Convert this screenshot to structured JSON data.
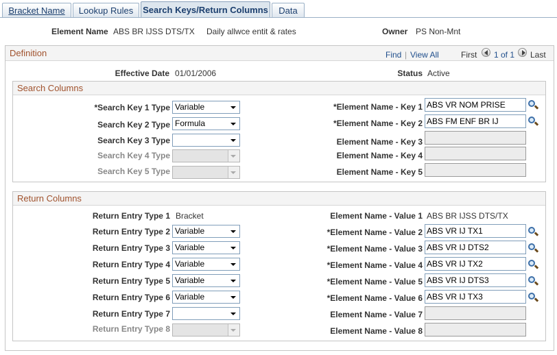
{
  "tabs": [
    {
      "label": "Bracket Name"
    },
    {
      "label": "Lookup Rules"
    },
    {
      "label": "Search Keys/Return Columns"
    },
    {
      "label": "Data"
    }
  ],
  "header": {
    "element_name_label": "Element Name",
    "element_name_value": "ABS BR IJSS DTS/TX",
    "description": "Daily allwce entit & rates",
    "owner_label": "Owner",
    "owner_value": "PS Non-Mnt"
  },
  "definition": {
    "title": "Definition",
    "find": "Find",
    "separator": "|",
    "view_all": "View All",
    "first": "First",
    "pager": "1 of 1",
    "last": "Last",
    "effective_date_label": "Effective Date",
    "effective_date_value": "01/01/2006",
    "status_label": "Status",
    "status_value": "Active"
  },
  "search_columns": {
    "title": "Search Columns",
    "rows": [
      {
        "type_label": "*Search Key 1 Type",
        "type_value": "Variable",
        "name_label": "*Element Name - Key 1",
        "name_value": "ABS VR NOM PRISE"
      },
      {
        "type_label": "Search Key 2 Type",
        "type_value": "Formula",
        "name_label": "*Element Name - Key 2",
        "name_value": "ABS FM ENF BR IJ"
      },
      {
        "type_label": "Search Key 3 Type",
        "type_value": "",
        "name_label": "Element Name - Key 3",
        "name_value": ""
      },
      {
        "type_label": "Search Key 4 Type",
        "type_value": "",
        "name_label": "Element Name - Key 4",
        "name_value": ""
      },
      {
        "type_label": "Search Key 5 Type",
        "type_value": "",
        "name_label": "Element Name - Key 5",
        "name_value": ""
      }
    ]
  },
  "return_columns": {
    "title": "Return Columns",
    "rows": [
      {
        "type_label": "Return Entry Type 1",
        "type_value": "Bracket",
        "name_label": "Element Name - Value 1",
        "name_value": "ABS BR IJSS DTS/TX"
      },
      {
        "type_label": "Return Entry Type 2",
        "type_value": "Variable",
        "name_label": "*Element Name - Value 2",
        "name_value": "ABS VR IJ TX1"
      },
      {
        "type_label": "Return Entry Type 3",
        "type_value": "Variable",
        "name_label": "*Element Name - Value 3",
        "name_value": "ABS VR IJ DTS2"
      },
      {
        "type_label": "Return Entry Type 4",
        "type_value": "Variable",
        "name_label": "*Element Name - Value 4",
        "name_value": "ABS VR IJ TX2"
      },
      {
        "type_label": "Return Entry Type 5",
        "type_value": "Variable",
        "name_label": "*Element Name - Value 5",
        "name_value": "ABS VR IJ DTS3"
      },
      {
        "type_label": "Return Entry Type 6",
        "type_value": "Variable",
        "name_label": "*Element Name - Value 6",
        "name_value": "ABS VR IJ TX3"
      },
      {
        "type_label": "Return Entry Type 7",
        "type_value": "",
        "name_label": "Element Name - Value 7",
        "name_value": ""
      },
      {
        "type_label": "Return Entry Type 8",
        "type_value": "",
        "name_label": "Element Name - Value 8",
        "name_value": ""
      }
    ]
  },
  "colors": {
    "tab_text": "#1c3f6e",
    "section_title": "#a0522d",
    "link": "#1f4e8c"
  },
  "icons": {
    "lookup": "magnifier-icon",
    "prev": "arrow-left-icon",
    "next": "arrow-right-icon",
    "dropdown": "chevron-down-icon"
  }
}
